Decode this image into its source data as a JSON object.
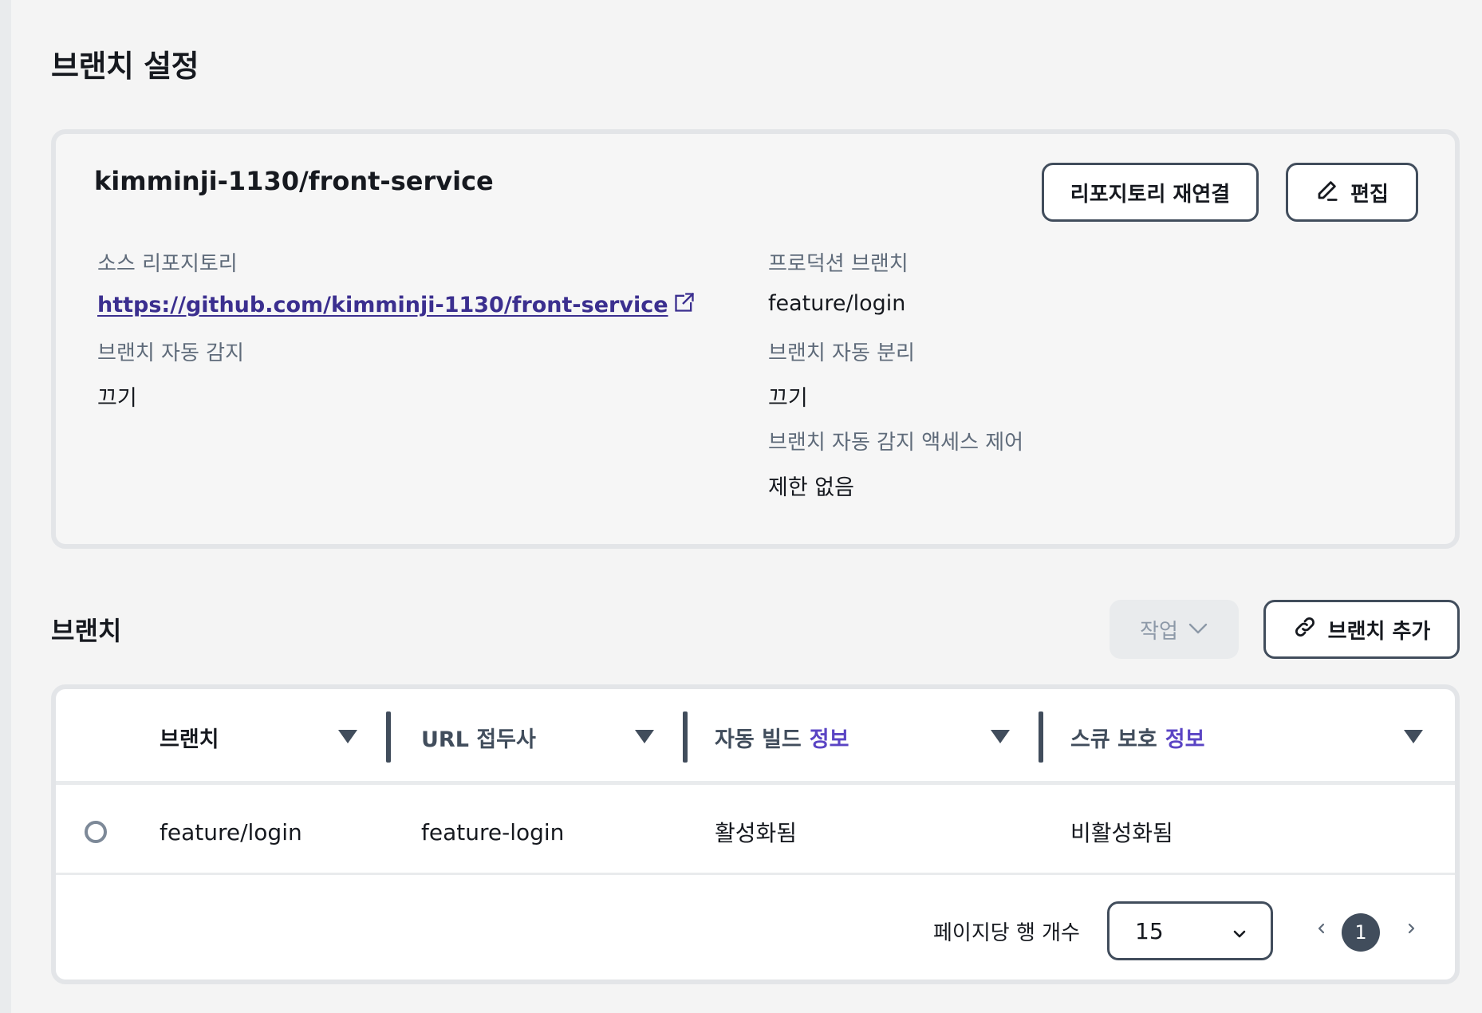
{
  "page": {
    "title": "브랜치 설정"
  },
  "repository": {
    "name": "kimminji-1130/front-service",
    "reconnect_label": "리포지토리 재연결",
    "edit_label": "편집",
    "source_label": "소스 리포지토리",
    "source_url": "https://github.com/kimminji-1130/front-service",
    "auto_detect_label": "브랜치 자동 감지",
    "auto_detect_value": "끄기",
    "production_branch_label": "프로덕션 브랜치",
    "production_branch_value": "feature/login",
    "auto_disconnect_label": "브랜치 자동 분리",
    "auto_disconnect_value": "끄기",
    "access_control_label": "브랜치 자동 감지 액세스 제어",
    "access_control_value": "제한 없음"
  },
  "branches": {
    "title": "브랜치",
    "actions_label": "작업",
    "add_label": "브랜치 추가",
    "columns": [
      {
        "label": "브랜치",
        "info": ""
      },
      {
        "label": "URL 접두사",
        "info": ""
      },
      {
        "label": "자동 빌드",
        "info": "정보"
      },
      {
        "label": "스큐 보호",
        "info": "정보"
      }
    ],
    "rows": [
      {
        "branch": "feature/login",
        "url_prefix": "feature-login",
        "auto_build": "활성화됨",
        "skew_protection": "비활성화됨"
      }
    ],
    "pagination": {
      "rows_per_page_label": "페이지당 행 개수",
      "rows_per_page_value": "15",
      "current_page": "1"
    }
  },
  "colors": {
    "link": "#3b2f8f",
    "info": "#5a44c4",
    "border_dark": "#414d5c",
    "background": "#f4f4f4"
  },
  "icons": [
    "external-link-icon",
    "pencil-icon",
    "chevron-down-icon",
    "link-icon",
    "sort-caret-icon",
    "chevron-left-icon",
    "chevron-right-icon"
  ]
}
